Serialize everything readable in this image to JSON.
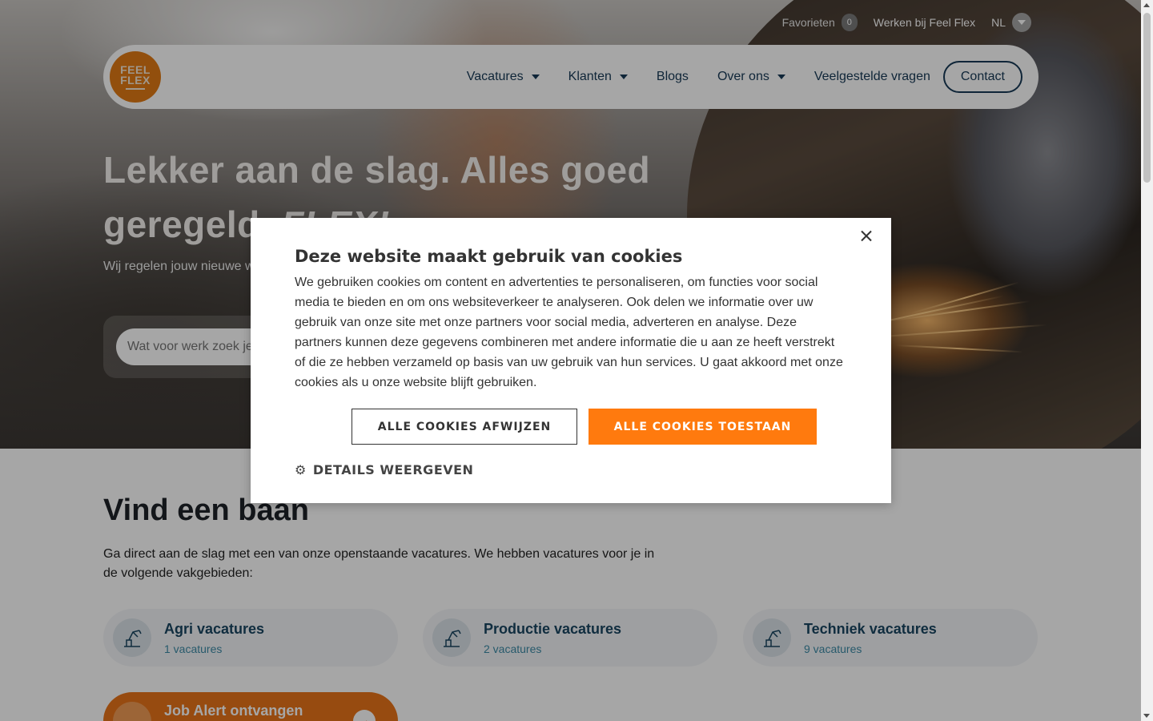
{
  "topbar": {
    "favorites_label": "Favorieten",
    "favorites_count": "0",
    "work_at_label": "Werken bij Feel Flex",
    "language": "NL"
  },
  "logo": {
    "line1": "FEEL",
    "line2": "FLEX"
  },
  "nav": {
    "items": [
      {
        "label": "Vacatures",
        "has_dropdown": true
      },
      {
        "label": "Klanten",
        "has_dropdown": true
      },
      {
        "label": "Blogs",
        "has_dropdown": false
      },
      {
        "label": "Over ons",
        "has_dropdown": true
      },
      {
        "label": "Veelgestelde vragen",
        "has_dropdown": false
      }
    ],
    "contact_label": "Contact"
  },
  "hero": {
    "title_part1": "Lekker aan de slag. Alles goed",
    "title_part2": "geregeld.",
    "title_flex": "FLEX!",
    "subtitle": "Wij regelen jouw nieuwe w",
    "search_placeholder": "Wat voor werk zoek je"
  },
  "jobs": {
    "title": "Vind een baan",
    "description": "Ga direct aan de slag met een van onze openstaande vacatures. We hebben vacatures voor je in de volgende vakgebieden:",
    "categories": [
      {
        "name": "Agri vacatures",
        "count": "1 vacatures"
      },
      {
        "name": "Productie vacatures",
        "count": "2 vacatures"
      },
      {
        "name": "Techniek vacatures",
        "count": "9 vacatures"
      }
    ],
    "alert_label": "Job Alert ontvangen"
  },
  "cookie_dialog": {
    "title": "Deze website maakt gebruik van cookies",
    "body": "We gebruiken cookies om content en advertenties te personaliseren, om functies voor social media te bieden en om ons websiteverkeer te analyseren. Ook delen we informatie over uw gebruik van onze site met onze partners voor social media, adverteren en analyse. Deze partners kunnen deze gegevens combineren met andere informatie die u aan ze heeft verstrekt of die ze hebben verzameld op basis van uw gebruik van hun services. U gaat akkoord met onze cookies als u onze website blijft gebruiken.",
    "reject_label": "ALLE COOKIES AFWIJZEN",
    "accept_label": "ALLE COOKIES TOESTAAN",
    "details_label": "DETAILS WEERGEVEN"
  },
  "colors": {
    "brand_orange": "#e07a14",
    "accept_orange": "#ff7a0e",
    "navy": "#173a56"
  }
}
